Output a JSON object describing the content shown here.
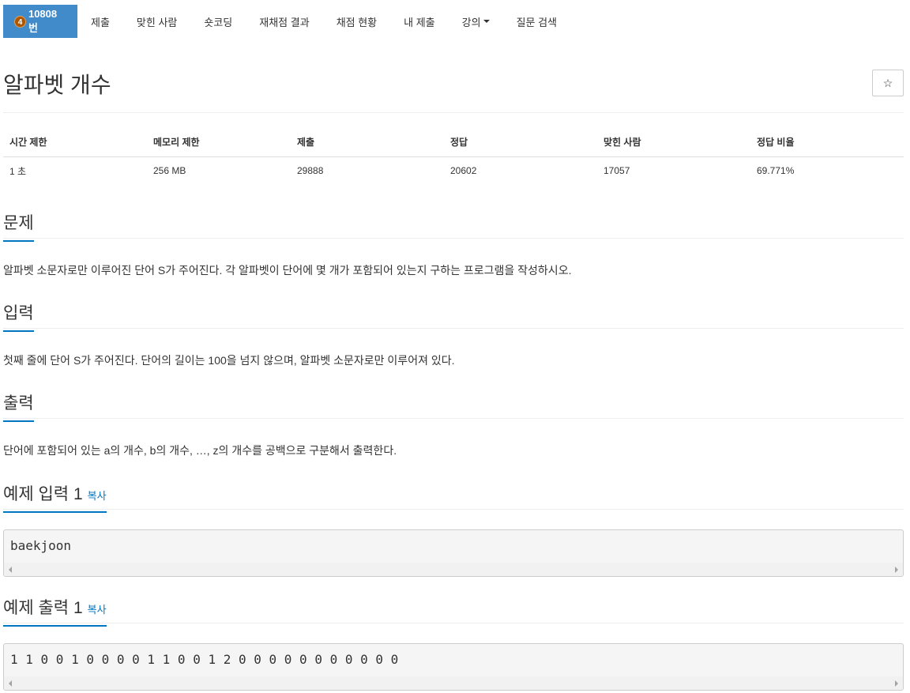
{
  "nav": {
    "tier_badge": "4",
    "problem_number": "10808번",
    "items": [
      "제출",
      "맞힌 사람",
      "숏코딩",
      "재채점 결과",
      "채점 현황",
      "내 제출",
      "강의",
      "질문 검색"
    ]
  },
  "title": "알파벳 개수",
  "star_label": "☆",
  "stats": {
    "headers": [
      "시간 제한",
      "메모리 제한",
      "제출",
      "정답",
      "맞힌 사람",
      "정답 비율"
    ],
    "values": [
      "1 초",
      "256 MB",
      "29888",
      "20602",
      "17057",
      "69.771%"
    ]
  },
  "sections": {
    "problem": {
      "title": "문제",
      "body": "알파벳 소문자로만 이루어진 단어 S가 주어진다. 각 알파벳이 단어에 몇 개가 포함되어 있는지 구하는 프로그램을 작성하시오."
    },
    "input": {
      "title": "입력",
      "body": "첫째 줄에 단어 S가 주어진다. 단어의 길이는 100을 넘지 않으며, 알파벳 소문자로만 이루어져 있다."
    },
    "output": {
      "title": "출력",
      "body": "단어에 포함되어 있는 a의 개수, b의 개수, …, z의 개수를 공백으로 구분해서 출력한다."
    }
  },
  "samples": {
    "input": {
      "title": "예제 입력 1",
      "copy_label": "복사",
      "content": "baekjoon"
    },
    "output": {
      "title": "예제 출력 1",
      "copy_label": "복사",
      "content": "1 1 0 0 1 0 0 0 0 1 1 0 0 1 2 0 0 0 0 0 0 0 0 0 0 0"
    }
  },
  "colors": {
    "nav_active_bg": "#428bca",
    "accent_underline": "#0076c0",
    "tier_badge": "#ad5600"
  }
}
